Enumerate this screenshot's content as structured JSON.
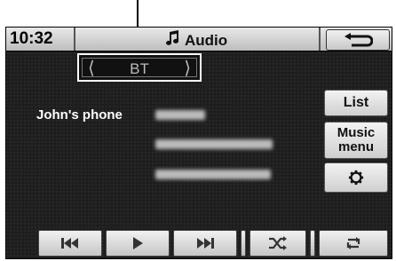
{
  "header": {
    "time": "10:32",
    "title": "Audio",
    "title_icon": "music-note-icon",
    "back_icon": "back-arrow-icon"
  },
  "source": {
    "label": "BT",
    "prev_icon": "chevron-left-icon",
    "next_icon": "chevron-right-icon"
  },
  "device": {
    "name": "John's phone"
  },
  "side_buttons": {
    "list": "List",
    "music_menu_line1": "Music",
    "music_menu_line2": "menu",
    "settings_icon": "gear-icon"
  },
  "controls": [
    "previous-track-icon",
    "play-icon",
    "next-track-icon",
    "shuffle-icon",
    "repeat-icon"
  ],
  "colors": {
    "background": "#1e1e1e",
    "button": "#e0e0e0",
    "text": "#ffffff"
  }
}
